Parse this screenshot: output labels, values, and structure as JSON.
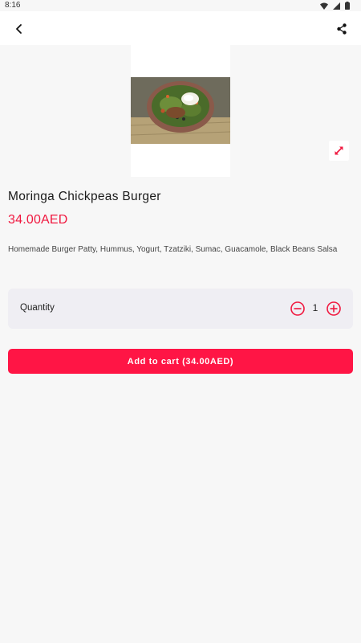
{
  "status_bar": {
    "time": "8:16",
    "icons": [
      "wifi-icon",
      "signal-icon",
      "battery-icon"
    ]
  },
  "app_bar": {
    "back_icon": "chevron-left-icon",
    "share_icon": "share-icon"
  },
  "product": {
    "image_alt": "salad-bowl-photo",
    "expand_icon": "expand-icon",
    "name": "Moringa Chickpeas Burger",
    "price": "34.00AED",
    "description": "Homemade Burger Patty, Hummus, Yogurt, Tzatziki, Sumac, Guacamole, Black Beans Salsa"
  },
  "quantity": {
    "label": "Quantity",
    "value": "1",
    "minus_icon": "minus-circle-icon",
    "plus_icon": "plus-circle-icon"
  },
  "cart": {
    "button_label": "Add to cart (34.00AED)"
  },
  "colors": {
    "accent": "#ff1545",
    "price": "#f0183f",
    "background": "#f7f7f7",
    "card": "#efeef3"
  }
}
